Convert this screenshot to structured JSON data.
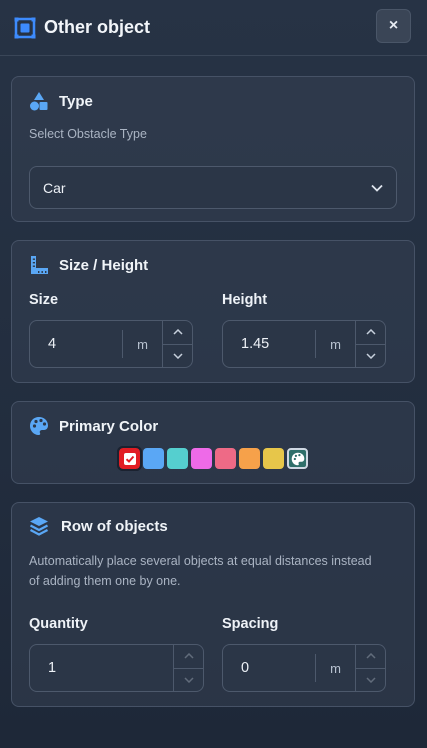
{
  "header": {
    "title": "Other object",
    "close_label": "×"
  },
  "type_section": {
    "title": "Type",
    "hint": "Select Obstacle Type",
    "selected": "Car"
  },
  "size_section": {
    "title": "Size / Height",
    "size_label": "Size",
    "size_value": "4",
    "size_unit": "m",
    "height_label": "Height",
    "height_value": "1.45",
    "height_unit": "m"
  },
  "color_section": {
    "title": "Primary Color",
    "swatches": [
      {
        "name": "red",
        "color": "#e11d24",
        "selected": true
      },
      {
        "name": "blue",
        "color": "#5aa7f5"
      },
      {
        "name": "teal",
        "color": "#55cfcf"
      },
      {
        "name": "magenta",
        "color": "#ee6ae8"
      },
      {
        "name": "pink",
        "color": "#ee6a86"
      },
      {
        "name": "orange",
        "color": "#f6a14a"
      },
      {
        "name": "yellow",
        "color": "#e7c64a"
      },
      {
        "name": "custom",
        "color": "#2f6f6a",
        "icon": "palette-icon"
      }
    ]
  },
  "row_section": {
    "title": "Row of objects",
    "hint_line1": "Automatically place several objects at equal distances instead",
    "hint_line2": "of adding them one by one.",
    "quantity_label": "Quantity",
    "quantity_value": "1",
    "spacing_label": "Spacing",
    "spacing_value": "0",
    "spacing_unit": "m"
  },
  "colors": {
    "accent": "#3d8bfd",
    "background": "#222d3e",
    "card": "#2f3a4b"
  }
}
